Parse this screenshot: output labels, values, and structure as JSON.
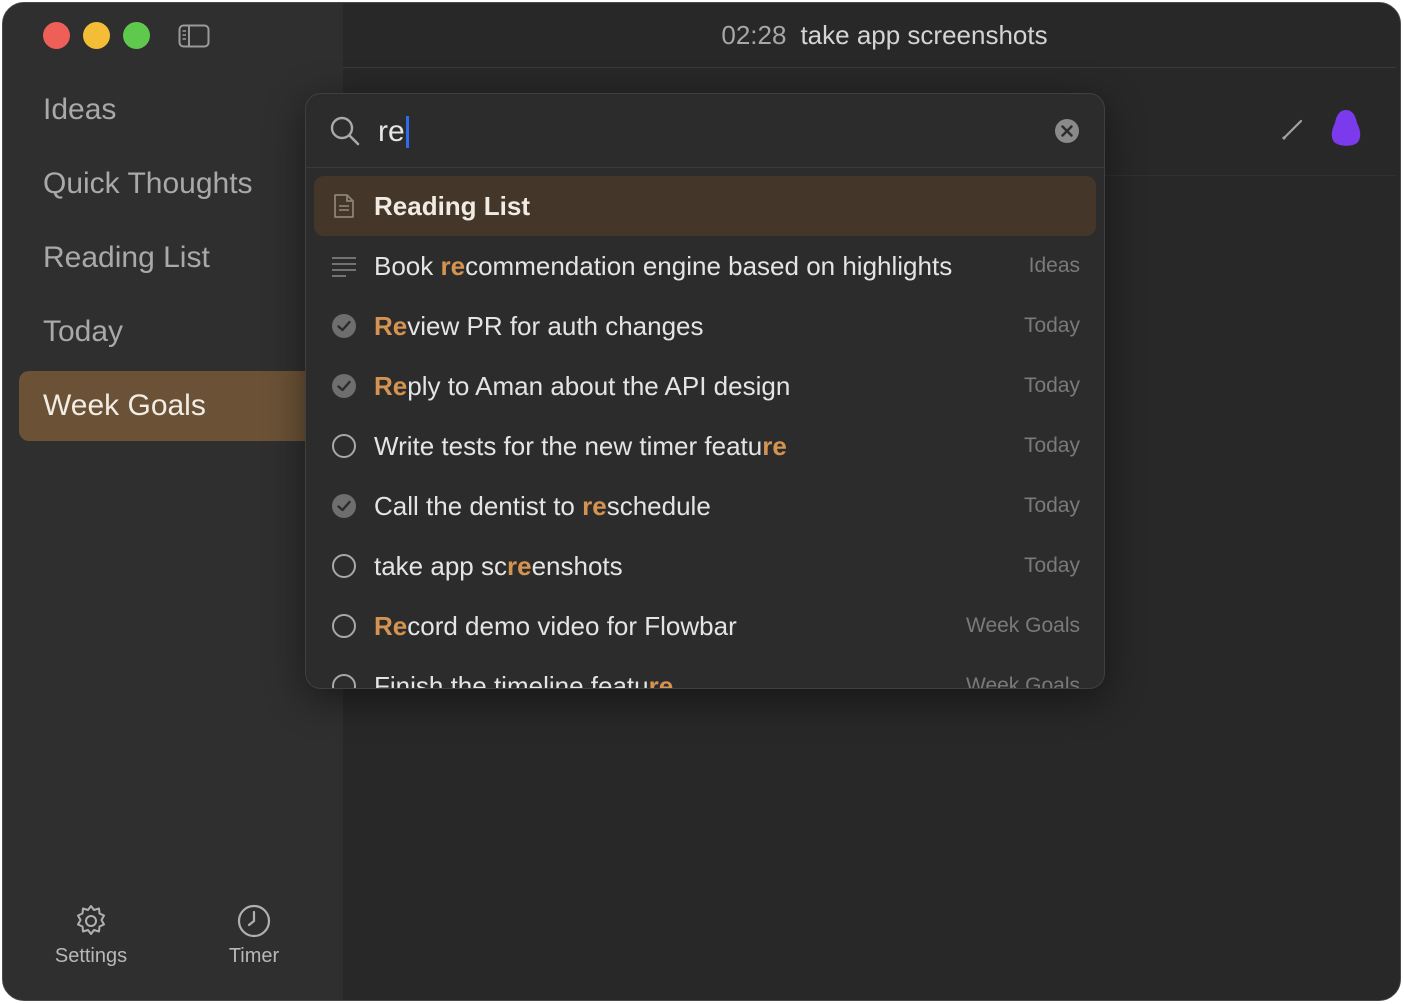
{
  "window": {
    "title_time": "02:28",
    "title_task": "take app screenshots"
  },
  "sidebar": {
    "items": [
      {
        "label": "Ideas",
        "active": false
      },
      {
        "label": "Quick Thoughts",
        "active": false
      },
      {
        "label": "Reading List",
        "active": false
      },
      {
        "label": "Today",
        "active": false
      },
      {
        "label": "Week Goals",
        "active": true
      }
    ],
    "footer": {
      "settings_label": "Settings",
      "timer_label": "Timer"
    }
  },
  "search": {
    "query": "re",
    "results": [
      {
        "icon": "document-icon",
        "pre": "",
        "match": "",
        "post": "Reading List",
        "list": ""
      },
      {
        "icon": "lines-icon",
        "pre": "Book ",
        "match": "re",
        "post": "commendation engine based on highlights",
        "list": "Ideas"
      },
      {
        "icon": "checked-circle-icon",
        "pre": "",
        "match": "Re",
        "post": "view PR for auth changes",
        "list": "Today"
      },
      {
        "icon": "checked-circle-icon",
        "pre": "",
        "match": "Re",
        "post": "ply to Aman about the API design",
        "list": "Today"
      },
      {
        "icon": "empty-circle-icon",
        "pre": "Write tests for the new timer featu",
        "match": "re",
        "post": "",
        "list": "Today"
      },
      {
        "icon": "checked-circle-icon",
        "pre": "Call the dentist to ",
        "match": "re",
        "post": "schedule",
        "list": "Today"
      },
      {
        "icon": "empty-circle-icon",
        "pre": "take app sc",
        "match": "re",
        "post": "enshots",
        "list": "Today"
      },
      {
        "icon": "empty-circle-icon",
        "pre": "",
        "match": "Re",
        "post": "cord demo video for Flowbar",
        "list": "Week Goals"
      },
      {
        "icon": "empty-circle-icon",
        "pre": "Finish the timeline featu",
        "match": "re",
        "post": "",
        "list": "Week Goals"
      }
    ]
  },
  "colors": {
    "accent": "#d49350",
    "selected_nav": "#6b5236",
    "selected_row": "#44372a",
    "avatar": "#7c3aed",
    "caret": "#2e6bf0"
  }
}
